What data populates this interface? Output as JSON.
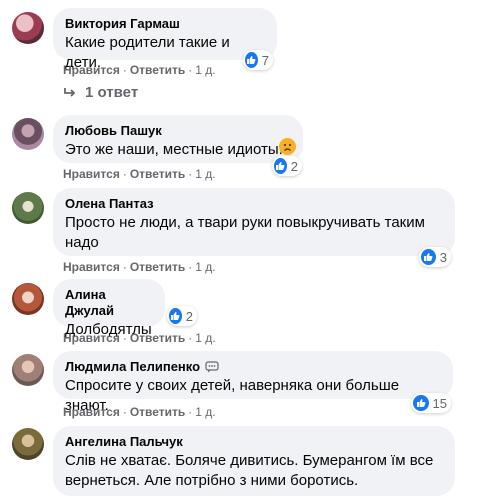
{
  "comments": [
    {
      "author": "Виктория Гармаш",
      "text": "Какие родители такие и дети.",
      "like": "Нравится",
      "reply": "Ответить",
      "time": "1 д.",
      "reactions": "7"
    },
    {
      "author": "Любовь Пашук",
      "text": "Это же наши, местные идиоты!",
      "like": "Нравится",
      "reply": "Ответить",
      "time": "1 д.",
      "reactions": "2"
    },
    {
      "author": "Олена Пантаз",
      "text": "Просто не люди, а твари руки повыкручивать таким надо",
      "like": "Нравится",
      "reply": "Ответить",
      "time": "1 д.",
      "reactions": "3"
    },
    {
      "author": "Алина Джулай",
      "text": "Долбодятлы",
      "like": "Нравится",
      "reply": "Ответить",
      "time": "1 д.",
      "reactions": "2"
    },
    {
      "author": "Людмила Пелипенко",
      "text": "Спросите у своих детей, наверняка они больше знают.",
      "like": "Нравится",
      "reply": "Ответить",
      "time": "1 д.",
      "reactions": "15"
    },
    {
      "author": "Ангелина Пальчук",
      "text": "Слів не хватає. Боляче дивитись. Бумерангом їм все вернеться. Але потрібно з ними боротись."
    }
  ],
  "replies_link": "1 ответ",
  "separator": "·",
  "icons": {
    "like": "thumbs-up-icon",
    "sad": "sad-face-icon",
    "reply_arrow": "reply-arrow-icon",
    "messenger": "messenger-icon"
  },
  "colors": {
    "like_blue": "#1877f2",
    "bubble": "#f0f2f5",
    "meta": "#65676b",
    "sad": "#f7b125"
  }
}
